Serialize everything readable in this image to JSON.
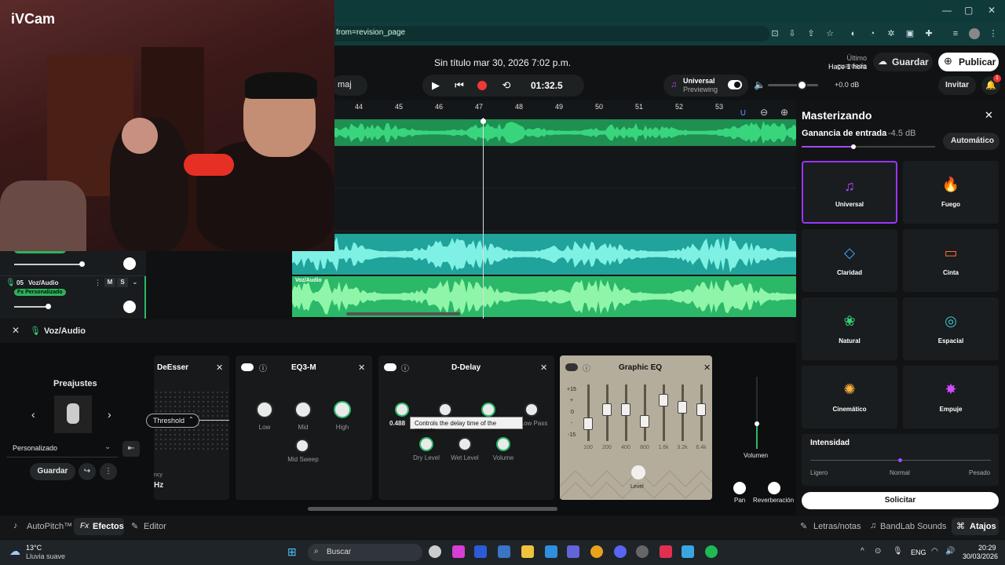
{
  "browser": {
    "url_fragment": "from=revision_page",
    "window_controls": [
      "—",
      "▢",
      "✕"
    ]
  },
  "webcam": {
    "label": "iVCam"
  },
  "header": {
    "doc_title": "Sin título mar 30, 2026 7:02 p.m.",
    "key_label": "maj",
    "time": "01:32.5",
    "universal_label": "Universal",
    "previewing": "Previewing",
    "volume_db": "+0.0 dB",
    "saved_label": "Último guardado",
    "saved_time": "Hace 1 hora",
    "save_button": "Guardar",
    "publish_button": "Publicar",
    "invite_button": "Invitar",
    "notif_count": "1"
  },
  "timeline": {
    "ticks": [
      "44",
      "45",
      "46",
      "47",
      "48",
      "49",
      "50",
      "51",
      "52",
      "53"
    ],
    "track_label_fx": "Fx Personalizado",
    "track_05_number": "05",
    "track_05_name": "Voz/Audio",
    "track_05_m": "M",
    "track_05_s": "S",
    "clip_label": "Voz/Audio"
  },
  "fx": {
    "title": "Voz/Audio",
    "presets_title": "Preajustes",
    "preset_name": "Personalizado",
    "save_button": "Guardar",
    "deesser": {
      "title": "DeEsser",
      "threshold": "Threshold",
      "hz": "Hz",
      "freq_suffix": "ncy"
    },
    "eq3": {
      "title": "EQ3-M",
      "knobs": [
        "Low",
        "Mid",
        "High"
      ],
      "sweep": "Mid Sweep"
    },
    "delay": {
      "title": "D-Delay",
      "value": "0.488",
      "tooltip": "Controls the delay time of the repeats.",
      "knobs_row1_label": "Low Pass",
      "knobs_row2": [
        "Dry Level",
        "Wet Level",
        "Volume"
      ]
    },
    "geq": {
      "title": "Graphic EQ",
      "db_marks": [
        "+15",
        "+",
        "0",
        "-",
        "-15"
      ],
      "bands": [
        "100",
        "200",
        "400",
        "800",
        "1.6k",
        "3.2k",
        "6.4k"
      ],
      "band_levels": [
        -0.4,
        0.1,
        0.1,
        -0.3,
        0.45,
        0.2,
        0.1
      ],
      "level": "Level"
    },
    "volume": "Volumen",
    "pan": "Pan",
    "reverb": "Reverberación"
  },
  "master": {
    "title": "Masterizando",
    "gain_label": "Ganancia de entrada",
    "gain_value": "-4.5 dB",
    "auto": "Automático",
    "presets": [
      {
        "label": "Universal",
        "icon": "♫",
        "color": "#a44aff"
      },
      {
        "label": "Fuego",
        "icon": "🔥",
        "color": "#ff4b3a"
      },
      {
        "label": "Claridad",
        "icon": "◇",
        "color": "#3da9ff"
      },
      {
        "label": "Cinta",
        "icon": "▭",
        "color": "#ff6a3a"
      },
      {
        "label": "Natural",
        "icon": "❀",
        "color": "#36d17a"
      },
      {
        "label": "Espacial",
        "icon": "◎",
        "color": "#36c8c8"
      },
      {
        "label": "Cinemático",
        "icon": "✺",
        "color": "#ffb43a"
      },
      {
        "label": "Empuje",
        "icon": "✸",
        "color": "#d04aff"
      }
    ],
    "intensity_title": "Intensidad",
    "intensity_levels": [
      "Ligero",
      "Normal",
      "Pesado"
    ],
    "request": "Solicitar"
  },
  "bottom_tabs": {
    "autopitch": "AutoPitch™",
    "efectos": "Efectos",
    "editor": "Editor",
    "lyrics": "Letras/notas",
    "sounds": "BandLab Sounds",
    "shortcuts": "Atajos"
  },
  "taskbar": {
    "temp": "13°C",
    "weather": "Lluvia suave",
    "search": "Buscar",
    "lang": "ENG",
    "time": "20:29",
    "date": "30/03/2026"
  }
}
